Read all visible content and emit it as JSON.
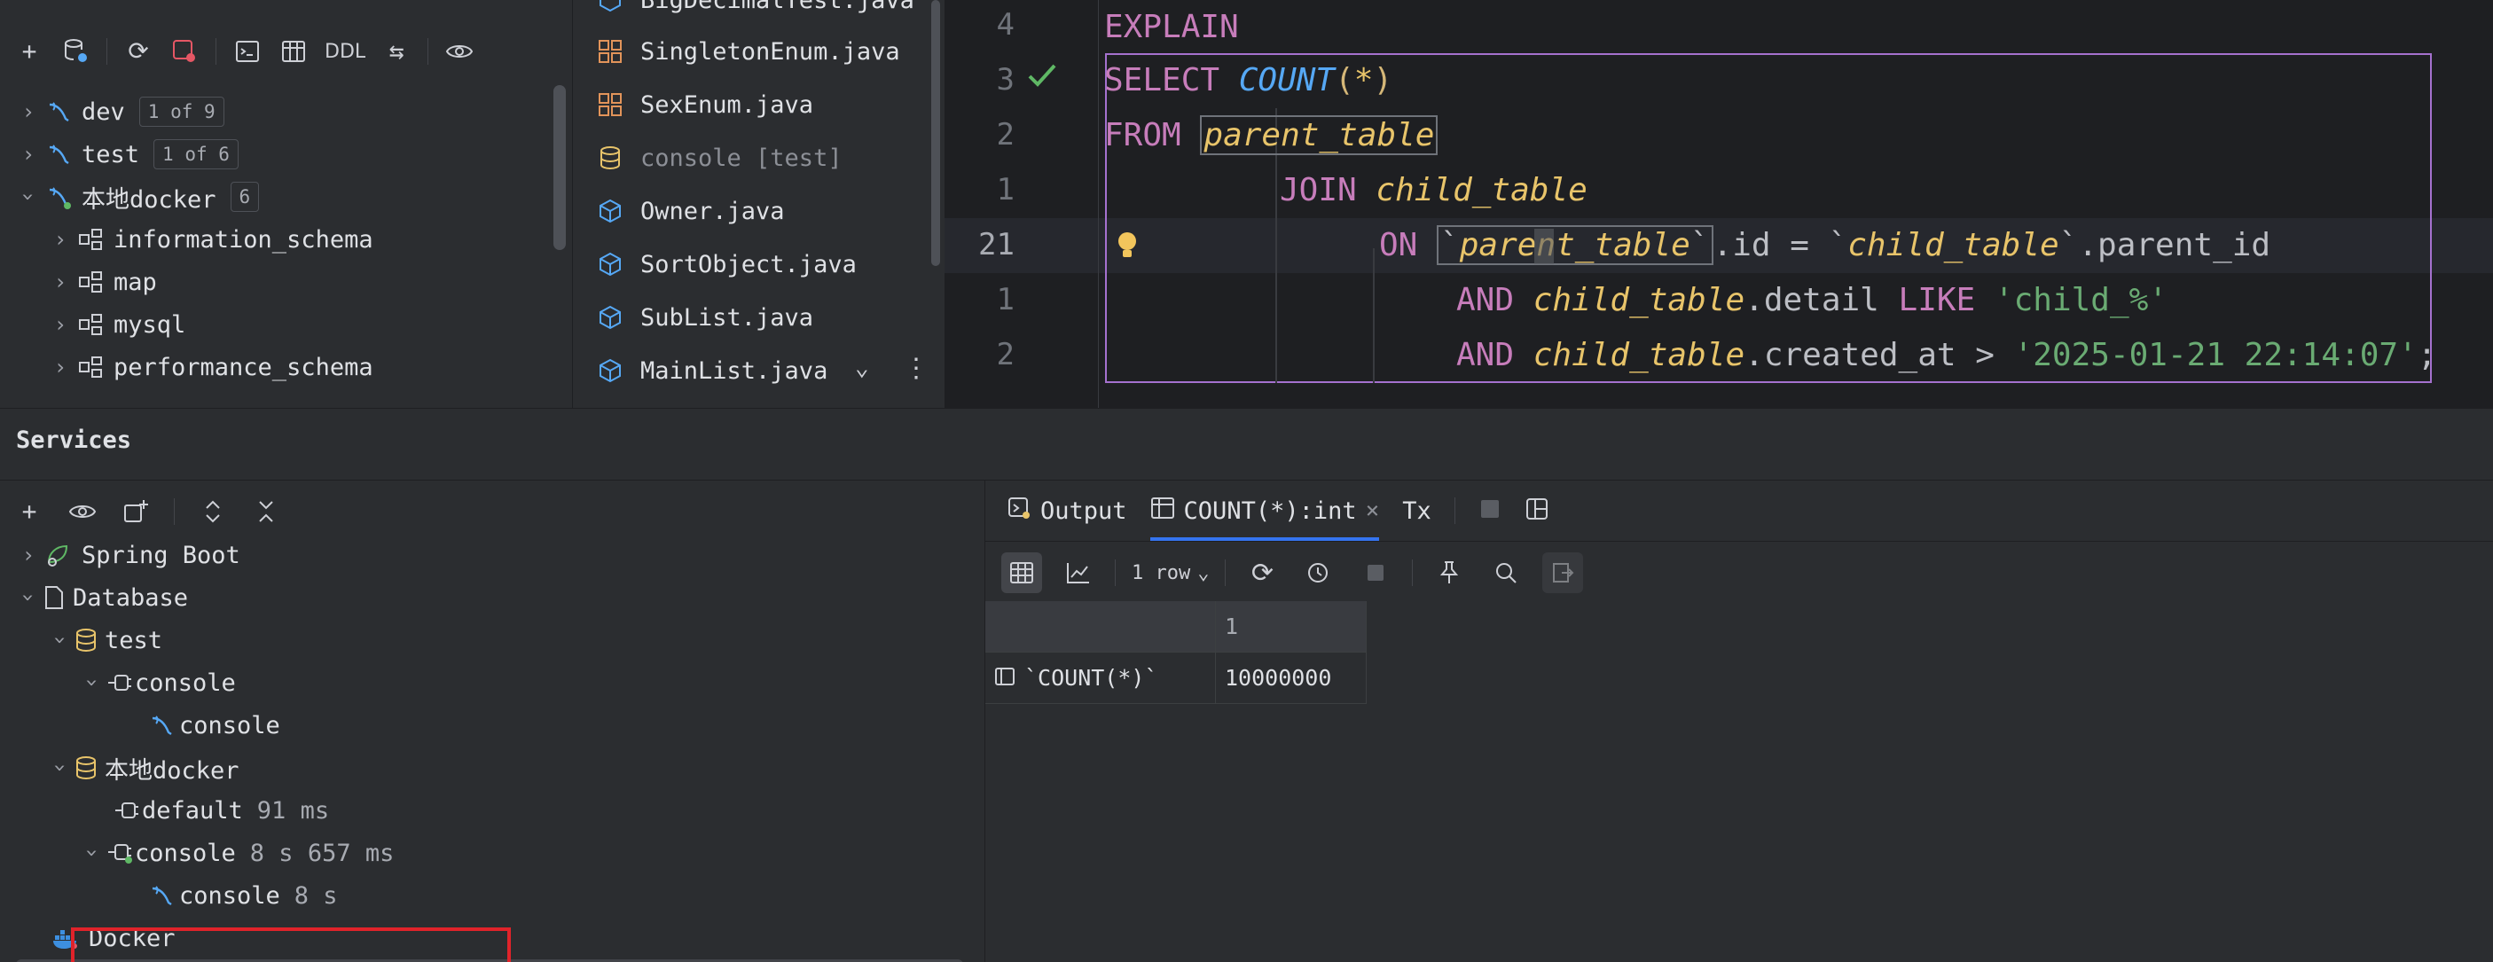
{
  "db_explorer": {
    "toolbar": {
      "ddl_label": "DDL"
    },
    "items": [
      {
        "name": "dev",
        "badge": "1 of 9"
      },
      {
        "name": "test",
        "badge": "1 of 6"
      },
      {
        "name": "本地docker",
        "badge": "6"
      },
      {
        "name": "information_schema"
      },
      {
        "name": "map"
      },
      {
        "name": "mysql"
      },
      {
        "name": "performance_schema"
      }
    ]
  },
  "files": {
    "items": [
      {
        "name": "BigDecimalTest.java"
      },
      {
        "name": "SingletonEnum.java"
      },
      {
        "name": "SexEnum.java"
      },
      {
        "name": "console [test]"
      },
      {
        "name": "Owner.java"
      },
      {
        "name": "SortObject.java"
      },
      {
        "name": "SubList.java"
      },
      {
        "name": "MainList.java"
      }
    ]
  },
  "editor": {
    "line_numbers": [
      "4",
      "3",
      "2",
      "1",
      "21",
      "1",
      "2"
    ],
    "lines": {
      "l1": {
        "kw": "EXPLAIN"
      },
      "l2": {
        "kw": "SELECT",
        "fn": "COUNT",
        "open": "(",
        "star": "*",
        "close": ")"
      },
      "l3": {
        "kw": "FROM",
        "table": "parent_table"
      },
      "l4": {
        "kw": "JOIN",
        "table": "child_table"
      },
      "l5": {
        "kw": "ON",
        "tick1": "`",
        "table1": "parent_table",
        "tick2": "`",
        "col1": ".id = ",
        "tick3": "`",
        "table2": "child_table",
        "tick4": "`",
        "col2": ".parent_id"
      },
      "l6": {
        "kw": "AND",
        "table": "child_table",
        "col": ".detail ",
        "op": "LIKE",
        "str": "'child_%'"
      },
      "l7": {
        "kw": "AND",
        "table": "child_table",
        "col": ".created_at > ",
        "str": "'2025-01-21 22:14:07'",
        "end": ";"
      }
    }
  },
  "services": {
    "title": "Services",
    "tree": [
      {
        "label": "Spring Boot"
      },
      {
        "label": "Database"
      },
      {
        "label": "test"
      },
      {
        "label": "console"
      },
      {
        "label": "console"
      },
      {
        "label": "本地docker"
      },
      {
        "label": "default",
        "time": "91 ms"
      },
      {
        "label": "console",
        "time": "8 s 657 ms"
      },
      {
        "label": "console",
        "time": "8 s"
      },
      {
        "label": "Docker"
      }
    ],
    "tabs": {
      "output": "Output",
      "result": "COUNT(*):int",
      "tx": "Tx"
    },
    "result_toolbar": {
      "rows": "1 row"
    },
    "grid": {
      "column_header": "1",
      "row_header": "`COUNT(*)`",
      "value": "10000000"
    }
  }
}
